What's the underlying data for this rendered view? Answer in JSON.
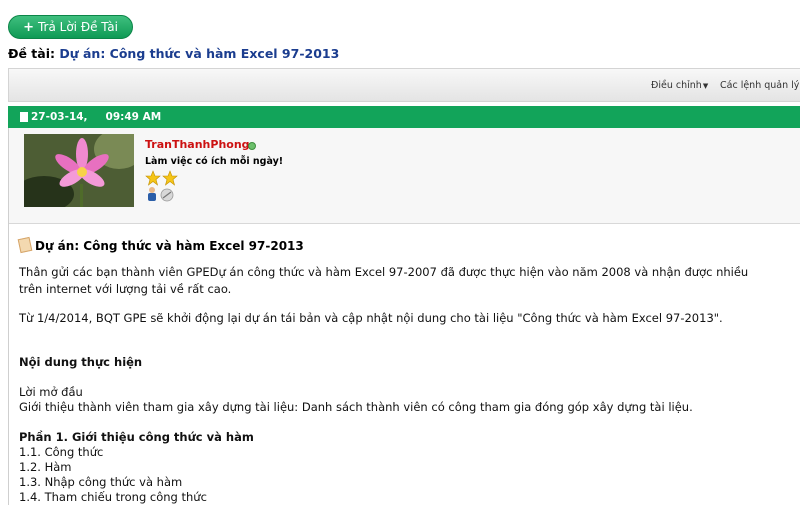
{
  "reply_button": {
    "icon": "plus-icon",
    "label": "Trả Lời Đề Tài"
  },
  "thread": {
    "prefix": "Đề tài:",
    "title": "Dự án: Công thức và hàm Excel 97-2013"
  },
  "toolbar": {
    "adjust": "Điều chỉnh",
    "admin": "Các lệnh quản lý"
  },
  "post": {
    "date": "27-03-14,",
    "time": "09:49 AM",
    "user": {
      "name": "TranThanhPhong",
      "title": "Làm việc có ích mỗi ngày!"
    },
    "title": "Dự án: Công thức và hàm Excel 97-2013",
    "para1_line1": "Thân gửi các bạn thành viên GPEDự án công thức và hàm Excel 97-2007 đã được thực hiện vào năm 2008 và nhận được nhiều",
    "para1_line2": "trên internet với lượng tải về rất cao.",
    "para2": "Từ 1/4/2014, BQT GPE sẽ khởi động lại dự án tái bản và cập nhật nội dung cho tài liệu \"Công thức và hàm Excel 97-2013\".",
    "section_heading": "Nội dung thực hiện",
    "intro": "Lời mở đầu",
    "members": "Giới thiệu thành viên tham gia xây dựng tài liệu: Danh sách thành viên có công tham gia đóng góp xây dựng tài liệu.",
    "part1_heading": "Phần 1. Giới thiệu công thức và hàm",
    "items": [
      "1.1. Công thức",
      "1.2. Hàm",
      "1.3. Nhập công thức và hàm",
      "1.4. Tham chiếu trong công thức"
    ]
  },
  "colors": {
    "green_header": "#12a45a",
    "username": "#cc1111",
    "title_blue": "#1b3d8f"
  }
}
